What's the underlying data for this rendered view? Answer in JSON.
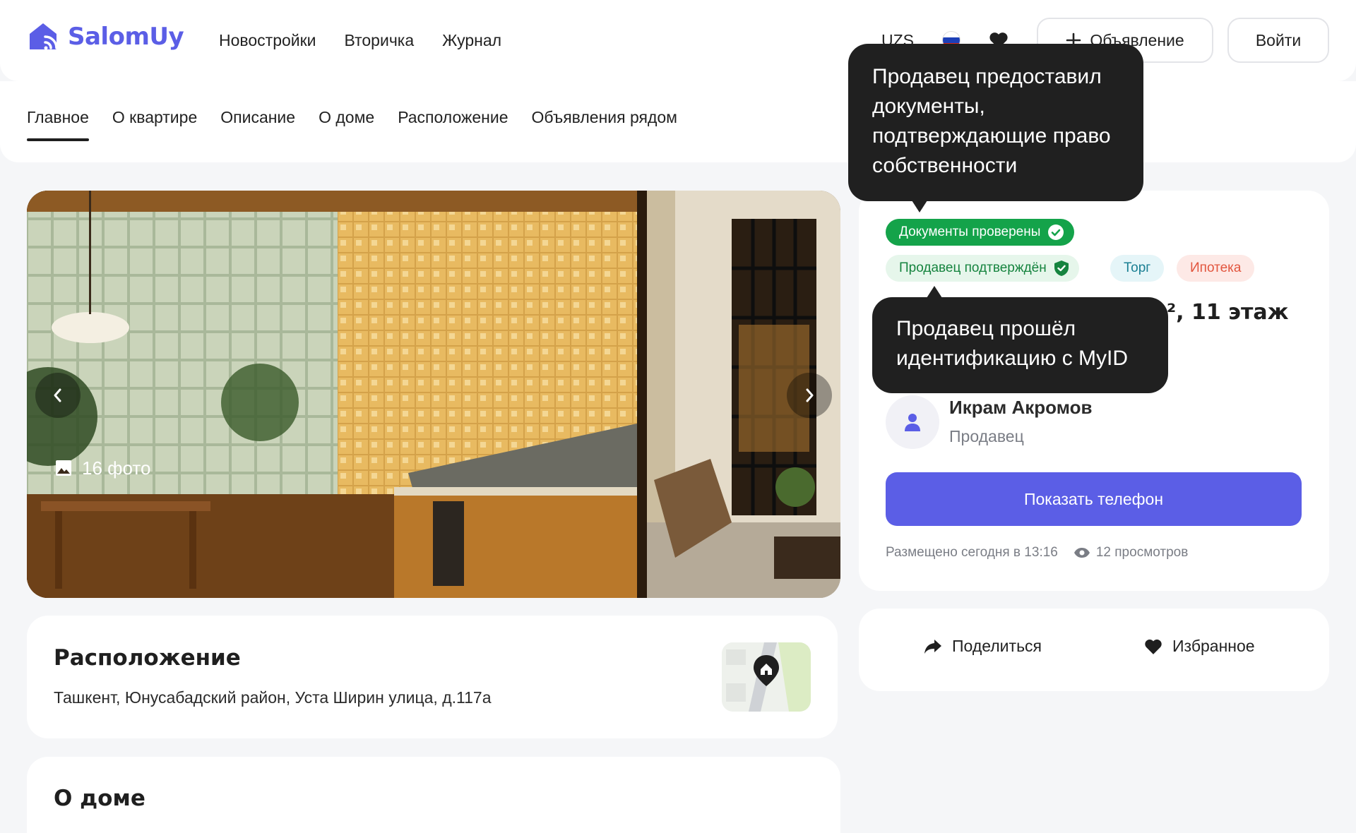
{
  "brand": {
    "name": "SalomUy",
    "color": "#5b5ee6"
  },
  "main_nav": [
    "Новостройки",
    "Вторичка",
    "Журнал"
  ],
  "header": {
    "currency": "UZS",
    "ad_button": "Объявление",
    "login_button": "Войти"
  },
  "sub_nav": [
    "Главное",
    "О квартире",
    "Описание",
    "О доме",
    "Расположение",
    "Объявления рядом"
  ],
  "gallery": {
    "photo_count": "16 фото"
  },
  "badges": {
    "docs": "Документы проверены",
    "seller": "Продавец подтверждён",
    "torg": "Торг",
    "ipoteka": "Ипотека"
  },
  "listing": {
    "title_fragment": "², 11 этаж"
  },
  "seller": {
    "name": "Икрам Акромов",
    "role": "Продавец"
  },
  "phone_button": "Показать телефон",
  "meta": {
    "posted": "Размещено сегодня в 13:16",
    "views": "12 просмотров"
  },
  "actions": {
    "share": "Поделиться",
    "favorite": "Избранное"
  },
  "location": {
    "title": "Расположение",
    "address": "Ташкент, Юнусабадский район, Уста Ширин улица, д.117а"
  },
  "house": {
    "title": "О доме"
  },
  "tooltips": {
    "docs": "Продавец предоставил документы, подтверждающие право собственности",
    "myid": "Продавец прошёл идентификацию с MyID"
  },
  "colors": {
    "verified_green": "#14a34a",
    "dark_tooltip": "#202020",
    "background": "#f5f6f8"
  }
}
